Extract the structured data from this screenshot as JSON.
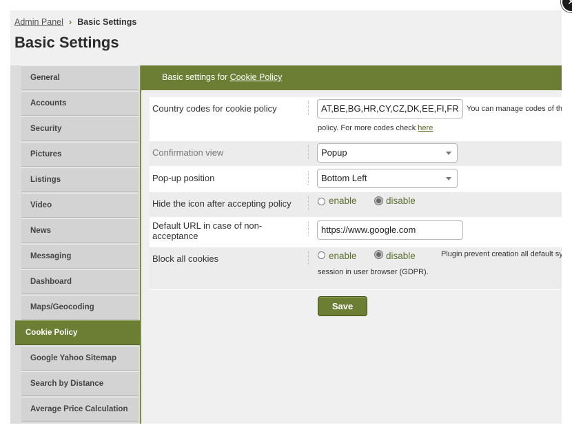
{
  "breadcrumb": {
    "parent": "Admin Panel",
    "current": "Basic Settings"
  },
  "page_title": "Basic Settings",
  "sidebar": {
    "items": [
      {
        "label": "General"
      },
      {
        "label": "Accounts"
      },
      {
        "label": "Security"
      },
      {
        "label": "Pictures"
      },
      {
        "label": "Listings"
      },
      {
        "label": "Video"
      },
      {
        "label": "News"
      },
      {
        "label": "Messaging"
      },
      {
        "label": "Dashboard"
      },
      {
        "label": "Maps/Geocoding"
      },
      {
        "label": "Cookie Policy"
      },
      {
        "label": "Google Yahoo Sitemap"
      },
      {
        "label": "Search by Distance"
      },
      {
        "label": "Average Price Calculation"
      }
    ],
    "active": "Cookie Policy"
  },
  "panel": {
    "header_prefix": "Basic settings for ",
    "header_link": "Cookie Policy"
  },
  "fields": {
    "country_codes": {
      "label": "Country codes for cookie policy",
      "value": "AT,BE,BG,HR,CY,CZ,DK,EE,FI,FR",
      "note_line1": "You can manage codes of th",
      "note_line2": "policy. For more codes check ",
      "note_link": "here"
    },
    "confirmation_view": {
      "label": "Confirmation view",
      "value": "Popup"
    },
    "popup_position": {
      "label": "Pop-up position",
      "value": "Bottom Left"
    },
    "hide_icon": {
      "label": "Hide the icon after accepting policy",
      "enable": "enable",
      "disable": "disable",
      "selected": "disable"
    },
    "default_url": {
      "label_line1": "Default URL in case of non-",
      "label_line2": "acceptance",
      "value": "https://www.google.com"
    },
    "block_cookies": {
      "label": "Block all cookies",
      "enable": "enable",
      "disable": "disable",
      "selected": "disable",
      "note_line1": "Plugin prevent creation all default sy",
      "note_line2": "session in user browser (GDPR)."
    }
  },
  "save_label": "Save",
  "colors": {
    "accent": "#6b7e34",
    "accent_dark": "#3f4d19",
    "radio_text": "#5c6e2e"
  },
  "icons": {
    "close": "close-icon",
    "breadcrumb_sep": "chevron-right-icon",
    "select_caret": "chevron-down-icon"
  }
}
